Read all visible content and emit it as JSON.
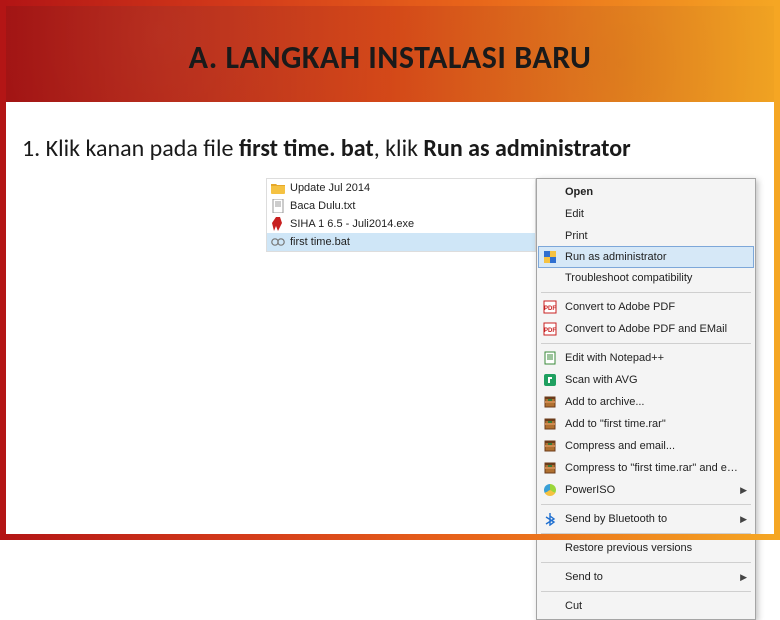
{
  "header": {
    "title": "A. LANGKAH INSTALASI BARU"
  },
  "instruction": {
    "prefix": "1. Klik kanan pada file ",
    "bold1": "first time. bat",
    "mid": ", klik ",
    "bold2": "Run as administrator"
  },
  "files": [
    {
      "name": "Update Jul 2014",
      "icon": "folder"
    },
    {
      "name": "Baca Dulu.txt",
      "icon": "txt"
    },
    {
      "name": "SIHA 1 6.5 - Juli2014.exe",
      "icon": "ribbon"
    },
    {
      "name": "first time.bat",
      "icon": "bat",
      "selected": true
    }
  ],
  "menu": [
    {
      "type": "item",
      "label": "Open",
      "bold": true
    },
    {
      "type": "item",
      "label": "Edit"
    },
    {
      "type": "item",
      "label": "Print"
    },
    {
      "type": "item",
      "label": "Run as administrator",
      "icon": "shield",
      "highlight": true
    },
    {
      "type": "item",
      "label": "Troubleshoot compatibility"
    },
    {
      "type": "sep"
    },
    {
      "type": "item",
      "label": "Convert to Adobe PDF",
      "icon": "pdf"
    },
    {
      "type": "item",
      "label": "Convert to Adobe PDF and EMail",
      "icon": "pdf"
    },
    {
      "type": "sep"
    },
    {
      "type": "item",
      "label": "Edit with Notepad++",
      "icon": "np"
    },
    {
      "type": "item",
      "label": "Scan with AVG",
      "icon": "avg"
    },
    {
      "type": "item",
      "label": "Add to archive...",
      "icon": "rar"
    },
    {
      "type": "item",
      "label": "Add to \"first time.rar\"",
      "icon": "rar"
    },
    {
      "type": "item",
      "label": "Compress and email...",
      "icon": "rar"
    },
    {
      "type": "item",
      "label": "Compress to \"first time.rar\" and email",
      "icon": "rar"
    },
    {
      "type": "item",
      "label": "PowerISO",
      "icon": "piso",
      "submenu": true
    },
    {
      "type": "sep"
    },
    {
      "type": "item",
      "label": "Send by Bluetooth to",
      "icon": "bt",
      "submenu": true
    },
    {
      "type": "sep"
    },
    {
      "type": "item",
      "label": "Restore previous versions"
    },
    {
      "type": "sep"
    },
    {
      "type": "item",
      "label": "Send to",
      "submenu": true
    },
    {
      "type": "sep"
    },
    {
      "type": "item",
      "label": "Cut"
    }
  ]
}
